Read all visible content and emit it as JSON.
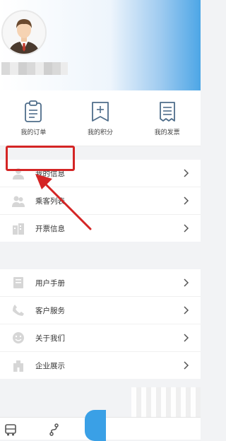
{
  "header": {
    "avatar_icon": "user-avatar",
    "username": ""
  },
  "quick_actions": [
    {
      "label": "我的订单",
      "icon": "order-clipboard-icon"
    },
    {
      "label": "我的积分",
      "icon": "points-bookmark-icon"
    },
    {
      "label": "我的发票",
      "icon": "invoice-receipt-icon"
    }
  ],
  "group1": [
    {
      "label": "我的信息",
      "icon": "person-icon"
    },
    {
      "label": "乘客列表",
      "icon": "passenger-icon"
    },
    {
      "label": "开票信息",
      "icon": "building-icon"
    }
  ],
  "group2": [
    {
      "label": "用户手册",
      "icon": "book-icon"
    },
    {
      "label": "客户服务",
      "icon": "phone-icon"
    },
    {
      "label": "关于我们",
      "icon": "smile-icon"
    },
    {
      "label": "企业展示",
      "icon": "company-icon"
    }
  ],
  "colors": {
    "accent": "#4da6e6",
    "highlight": "#d42525"
  }
}
